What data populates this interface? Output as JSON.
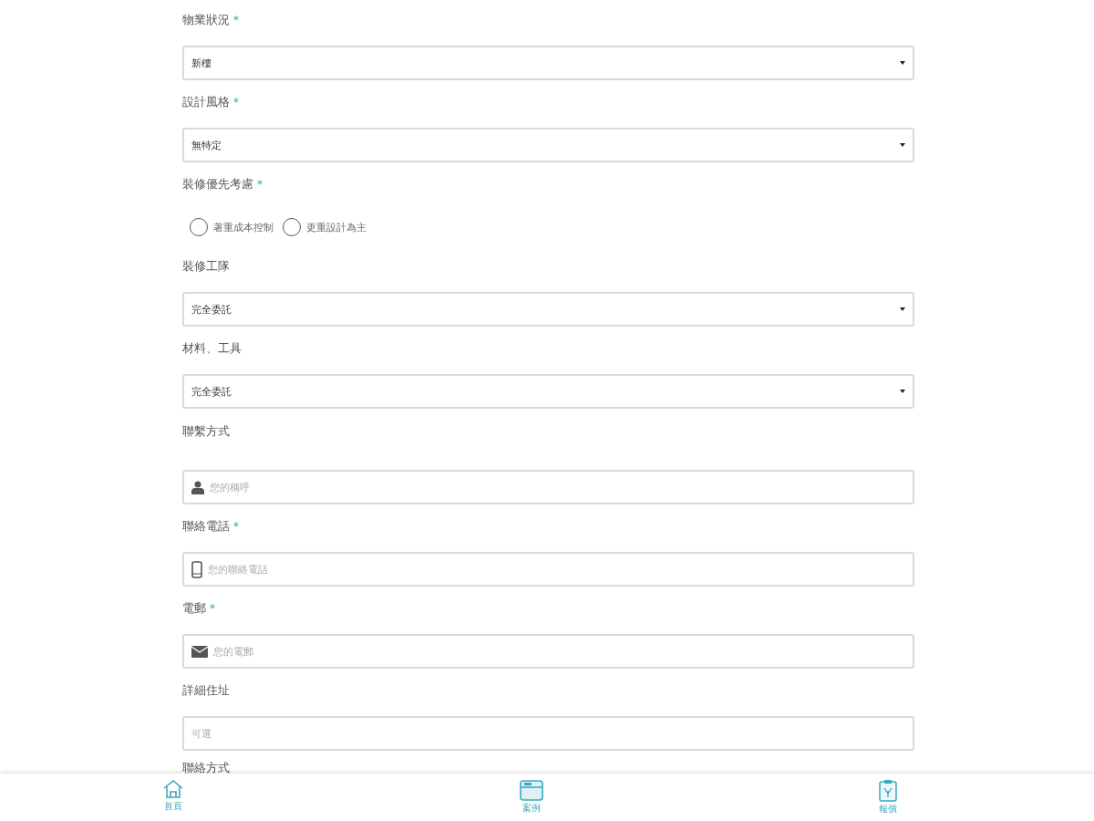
{
  "form": {
    "items": [
      {
        "kind": "select",
        "label": "物業狀況",
        "required_mark": "*",
        "value": "新樓"
      },
      {
        "kind": "select",
        "label": "設計風格",
        "required_mark": "*",
        "value": "無特定"
      },
      {
        "kind": "radio",
        "label": "裝修優先考慮",
        "required_mark": "*",
        "options": [
          {
            "label": "著重成本控制",
            "selected": false
          },
          {
            "label": "更重設計為主",
            "selected": false
          }
        ]
      },
      {
        "kind": "select",
        "label": "裝修工隊",
        "value": "完全委託"
      },
      {
        "kind": "select",
        "label": "材料、工具",
        "value": "完全委託"
      },
      {
        "kind": "heading",
        "label": "聯繫方式"
      },
      {
        "kind": "name",
        "placeholder": "您的稱呼"
      },
      {
        "kind": "phone",
        "label": "聯絡電話",
        "required_mark": "*",
        "placeholder": "您的聯絡電話"
      },
      {
        "kind": "email",
        "label": "電郵",
        "required_mark": "*",
        "placeholder": "您的電郵"
      },
      {
        "kind": "text",
        "label": "詳細住址",
        "placeholder": "可選"
      },
      {
        "kind": "label",
        "label": "聯絡方式"
      }
    ]
  },
  "bottom_nav": [
    {
      "label": "首頁"
    },
    {
      "label": "案例"
    },
    {
      "label": "報價"
    }
  ]
}
